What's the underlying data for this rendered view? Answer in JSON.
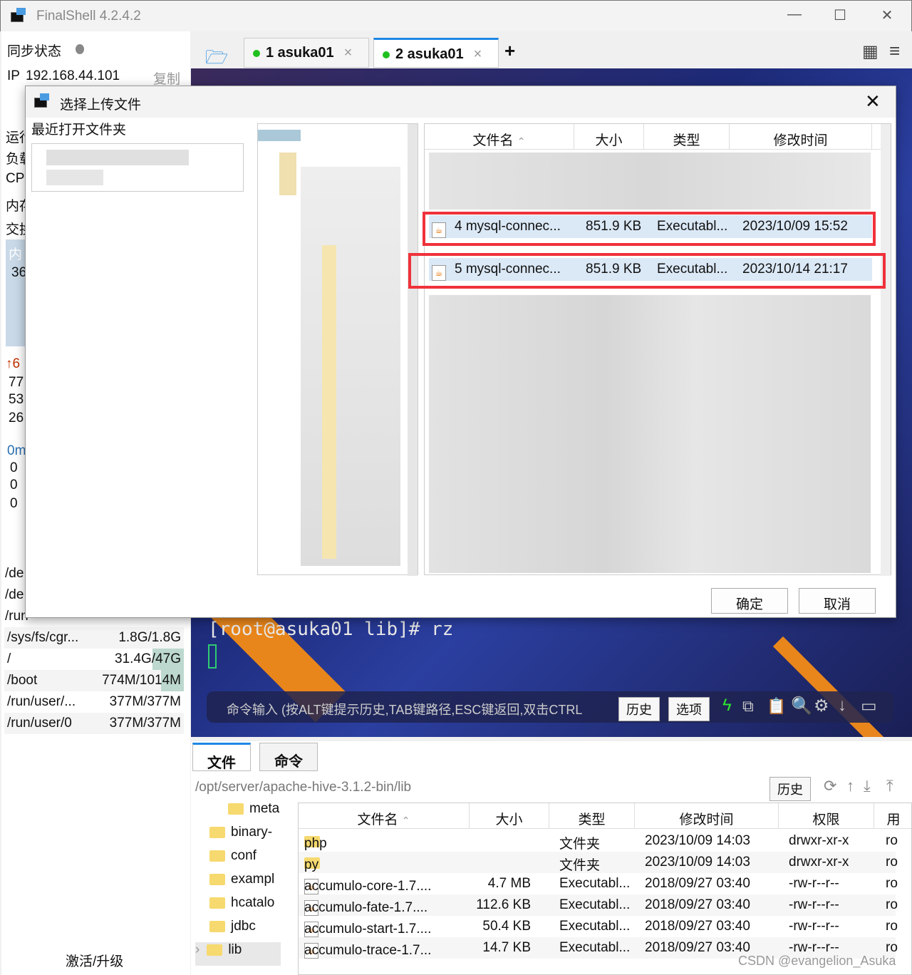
{
  "window": {
    "title": "FinalShell 4.2.4.2"
  },
  "sidebar": {
    "sync_label": "同步状态",
    "ip_label": "IP",
    "ip": "192.168.44.101",
    "copy": "复制",
    "partial": [
      "运行",
      "负载",
      "CPU",
      "内存",
      "交换",
      "内",
      "36",
      "6",
      "77",
      "53",
      "26",
      "0m",
      "0",
      "0",
      "0",
      "/de",
      "/de",
      "/run"
    ],
    "disks": [
      {
        "name": "/sys/fs/cgr...",
        "value": "1.8G/1.8G"
      },
      {
        "name": "/",
        "value": "31.4G/47G"
      },
      {
        "name": "/boot",
        "value": "774M/1014M"
      },
      {
        "name": "/run/user/...",
        "value": "377M/377M"
      },
      {
        "name": "/run/user/0",
        "value": "377M/377M"
      }
    ],
    "activate": "激活/升级"
  },
  "tabs": [
    {
      "label": "1 asuka01"
    },
    {
      "label": "2 asuka01"
    }
  ],
  "terminal": {
    "prompt": "[root@asuka01 lib]# rz",
    "cmd_placeholder": "命令输入 (按ALT键提示历史,TAB键路径,ESC键返回,双击CTRL",
    "history": "历史",
    "options": "选项"
  },
  "dialog": {
    "title": "选择上传文件",
    "recent": "最近打开文件夹",
    "columns": [
      "文件名",
      "大小",
      "类型",
      "修改时间"
    ],
    "rows": [
      {
        "name": "4 mysql-connec...",
        "size": "851.9 KB",
        "type": "Executabl...",
        "time": "2023/10/09 15:52"
      },
      {
        "name": "5 mysql-connec...",
        "size": "851.9 KB",
        "type": "Executabl...",
        "time": "2023/10/14 21:17"
      }
    ],
    "ok": "确定",
    "cancel": "取消"
  },
  "files": {
    "tab_files": "文件",
    "tab_cmd": "命令",
    "path": "/opt/server/apache-hive-3.1.2-bin/lib",
    "history": "历史",
    "tree": [
      "meta",
      "binary-",
      "conf",
      "exampl",
      "hcatalo",
      "jdbc",
      "lib"
    ],
    "columns": [
      "文件名",
      "大小",
      "类型",
      "修改时间",
      "权限",
      "用"
    ],
    "rows": [
      {
        "name": "php",
        "size": "",
        "type": "文件夹",
        "time": "2023/10/09 14:03",
        "perm": "drwxr-xr-x",
        "user": "ro",
        "folder": true
      },
      {
        "name": "py",
        "size": "",
        "type": "文件夹",
        "time": "2023/10/09 14:03",
        "perm": "drwxr-xr-x",
        "user": "ro",
        "folder": true
      },
      {
        "name": "accumulo-core-1.7....",
        "size": "4.7 MB",
        "type": "Executabl...",
        "time": "2018/09/27 03:40",
        "perm": "-rw-r--r--",
        "user": "ro"
      },
      {
        "name": "accumulo-fate-1.7....",
        "size": "112.6 KB",
        "type": "Executabl...",
        "time": "2018/09/27 03:40",
        "perm": "-rw-r--r--",
        "user": "ro"
      },
      {
        "name": "accumulo-start-1.7....",
        "size": "50.4 KB",
        "type": "Executabl...",
        "time": "2018/09/27 03:40",
        "perm": "-rw-r--r--",
        "user": "ro"
      },
      {
        "name": "accumulo-trace-1.7...",
        "size": "14.7 KB",
        "type": "Executabl...",
        "time": "2018/09/27 03:40",
        "perm": "-rw-r--r--",
        "user": "ro"
      }
    ]
  },
  "watermark": "CSDN @evangelion_Asuka",
  "colors": {
    "accent": "#1e88e5",
    "highlight": "#f0313a",
    "online": "#1ec01e"
  }
}
